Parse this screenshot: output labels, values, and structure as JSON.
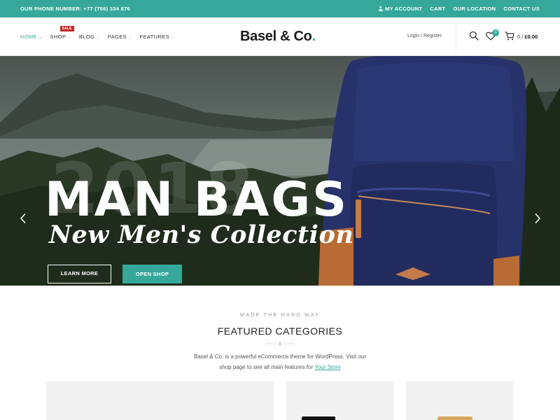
{
  "topbar": {
    "phone": "OUR PHONE NUMBER: +77 (756) 334 876",
    "links": [
      "MY ACCOUNT",
      "CART",
      "OUR LOCATION",
      "CONTACT US"
    ]
  },
  "nav": {
    "items": [
      "HOME",
      "SHOP",
      "BLOG",
      "PAGES",
      "FEATURES"
    ],
    "sale_badge": "SALE"
  },
  "brand": {
    "name": "Basel & Co",
    "dot": "."
  },
  "account": {
    "login": "Login / Register"
  },
  "cart": {
    "wishlist_count": "0",
    "count": "0",
    "separator": "/",
    "total": "£0.00"
  },
  "hero": {
    "year": "2018",
    "headline": "MAN BAGS",
    "subheadline": "New Men's Collection",
    "learn_more": "LEARN MORE",
    "open_shop": "OPEN SHOP"
  },
  "featured": {
    "eyebrow": "MADE THE HARD WAY",
    "title": "FEATURED CATEGORIES",
    "description_line1": "Basel & Co. is a powerful eCommerce theme for WordPress. Visit our",
    "description_line2_prefix": "shop page to see all main features for ",
    "description_link": "Your Store"
  },
  "colors": {
    "accent": "#35a89a",
    "sale": "#c62828",
    "topbar": "#35a89a"
  },
  "icons": [
    "user-icon",
    "search-icon",
    "heart-icon",
    "cart-icon",
    "chevron-left-icon",
    "chevron-right-icon"
  ]
}
